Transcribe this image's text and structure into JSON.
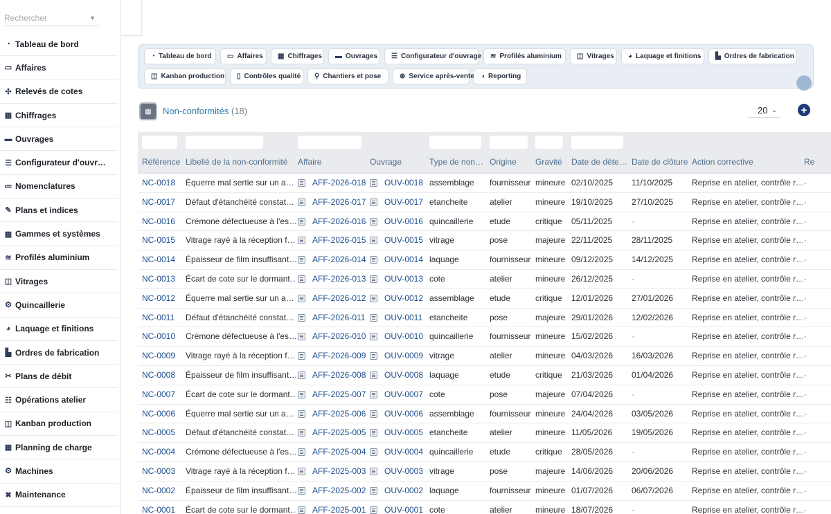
{
  "search": {
    "placeholder": "Rechercher"
  },
  "sidebar": {
    "items": [
      {
        "label": "Tableau de bord",
        "icon": "gauge-icon"
      },
      {
        "label": "Affaires",
        "icon": "briefcase-icon"
      },
      {
        "label": "Relevés de cotes",
        "icon": "move-icon"
      },
      {
        "label": "Chiffrages",
        "icon": "calculator-icon"
      },
      {
        "label": "Ouvrages",
        "icon": "window-icon"
      },
      {
        "label": "Configurateur d'ouvr…",
        "icon": "sliders-icon"
      },
      {
        "label": "Nomenclatures",
        "icon": "list-icon"
      },
      {
        "label": "Plans et indices",
        "icon": "drafting-icon"
      },
      {
        "label": "Gammes et systèmes",
        "icon": "grid-icon"
      },
      {
        "label": "Profilés aluminium",
        "icon": "layers-icon"
      },
      {
        "label": "Vitrages",
        "icon": "glass-icon"
      },
      {
        "label": "Quincaillerie",
        "icon": "gears-icon"
      },
      {
        "label": "Laquage et finitions",
        "icon": "palette-icon"
      },
      {
        "label": "Ordres de fabrication",
        "icon": "factory-icon"
      },
      {
        "label": "Plans de débit",
        "icon": "scissors-icon"
      },
      {
        "label": "Opérations atelier",
        "icon": "task-list-icon"
      },
      {
        "label": "Kanban production",
        "icon": "kanban-icon"
      },
      {
        "label": "Planning de charge",
        "icon": "calendar-icon"
      },
      {
        "label": "Machines",
        "icon": "cogs-icon"
      },
      {
        "label": "Maintenance",
        "icon": "tools-icon"
      }
    ]
  },
  "shortcuts": {
    "row1": [
      {
        "label": "Tableau de bord",
        "icon": "gauge-icon"
      },
      {
        "label": "Affaires",
        "icon": "briefcase-icon"
      },
      {
        "label": "Chiffrages",
        "icon": "calculator-icon"
      },
      {
        "label": "Ouvrages",
        "icon": "window-icon"
      },
      {
        "label": "Configurateur d'ouvrage",
        "icon": "sliders-icon"
      },
      {
        "label": "Profilés aluminium",
        "icon": "layers-icon"
      },
      {
        "label": "Vitrages",
        "icon": "glass-icon"
      },
      {
        "label": "Laquage et finitions",
        "icon": "palette-icon"
      },
      {
        "label": "Ordres de fabrication",
        "icon": "factory-icon"
      }
    ],
    "row2": [
      {
        "label": "Kanban production",
        "icon": "kanban-icon"
      },
      {
        "label": "Contrôles qualité",
        "icon": "clipboard-icon"
      },
      {
        "label": "Chantiers et pose",
        "icon": "map-pin-icon"
      },
      {
        "label": "Service après-vente",
        "icon": "lifebuoy-icon"
      },
      {
        "label": "Reporting",
        "icon": "pie-chart-icon"
      }
    ]
  },
  "list": {
    "title": "Non-conformités",
    "count": "(18)",
    "page_size": "20",
    "add_label": "+"
  },
  "table": {
    "columns": [
      "Référence",
      "Libellé de la non-conformité",
      "Affaire",
      "Ouvrage",
      "Type de non…",
      "Origine",
      "Gravité",
      "Date de déte…",
      "Date de clôture",
      "Action corrective",
      "Re"
    ],
    "rows": [
      {
        "ref": "NC-0018",
        "label": "Équerre mal sertie sur un a…",
        "affaire": "AFF-2026-018",
        "ouvrage": "OUV-0018",
        "type": "assemblage",
        "origine": "fournisseur",
        "gravite": "mineure",
        "detect": "02/10/2025",
        "cloture": "11/10/2025",
        "action": "Reprise en atelier, contrôle r…",
        "re": "-"
      },
      {
        "ref": "NC-0017",
        "label": "Défaut d'étanchéité constat…",
        "affaire": "AFF-2026-017",
        "ouvrage": "OUV-0017",
        "type": "etancheite",
        "origine": "atelier",
        "gravite": "mineure",
        "detect": "19/10/2025",
        "cloture": "27/10/2025",
        "action": "Reprise en atelier, contrôle r…",
        "re": "-"
      },
      {
        "ref": "NC-0016",
        "label": "Crémone défectueuse à l'es…",
        "affaire": "AFF-2026-016",
        "ouvrage": "OUV-0016",
        "type": "quincaillerie",
        "origine": "etude",
        "gravite": "critique",
        "detect": "05/11/2025",
        "cloture": "-",
        "action": "Reprise en atelier, contrôle r…",
        "re": "-"
      },
      {
        "ref": "NC-0015",
        "label": "Vitrage rayé à la réception f…",
        "affaire": "AFF-2026-015",
        "ouvrage": "OUV-0015",
        "type": "vitrage",
        "origine": "pose",
        "gravite": "majeure",
        "detect": "22/11/2025",
        "cloture": "28/11/2025",
        "action": "Reprise en atelier, contrôle r…",
        "re": "-"
      },
      {
        "ref": "NC-0014",
        "label": "Épaisseur de film insuffisant…",
        "affaire": "AFF-2026-014",
        "ouvrage": "OUV-0014",
        "type": "laquage",
        "origine": "fournisseur",
        "gravite": "mineure",
        "detect": "09/12/2025",
        "cloture": "14/12/2025",
        "action": "Reprise en atelier, contrôle r…",
        "re": "-"
      },
      {
        "ref": "NC-0013",
        "label": "Écart de cote sur le dormant…",
        "affaire": "AFF-2026-013",
        "ouvrage": "OUV-0013",
        "type": "cote",
        "origine": "atelier",
        "gravite": "mineure",
        "detect": "26/12/2025",
        "cloture": "-",
        "action": "Reprise en atelier, contrôle r…",
        "re": "-"
      },
      {
        "ref": "NC-0012",
        "label": "Équerre mal sertie sur un a…",
        "affaire": "AFF-2026-012",
        "ouvrage": "OUV-0012",
        "type": "assemblage",
        "origine": "etude",
        "gravite": "critique",
        "detect": "12/01/2026",
        "cloture": "27/01/2026",
        "action": "Reprise en atelier, contrôle r…",
        "re": "-"
      },
      {
        "ref": "NC-0011",
        "label": "Défaut d'étanchéité constat…",
        "affaire": "AFF-2026-011",
        "ouvrage": "OUV-0011",
        "type": "etancheite",
        "origine": "pose",
        "gravite": "majeure",
        "detect": "29/01/2026",
        "cloture": "12/02/2026",
        "action": "Reprise en atelier, contrôle r…",
        "re": "-"
      },
      {
        "ref": "NC-0010",
        "label": "Crémone défectueuse à l'es…",
        "affaire": "AFF-2026-010",
        "ouvrage": "OUV-0010",
        "type": "quincaillerie",
        "origine": "fournisseur",
        "gravite": "mineure",
        "detect": "15/02/2026",
        "cloture": "-",
        "action": "Reprise en atelier, contrôle r…",
        "re": "-"
      },
      {
        "ref": "NC-0009",
        "label": "Vitrage rayé à la réception f…",
        "affaire": "AFF-2026-009",
        "ouvrage": "OUV-0009",
        "type": "vitrage",
        "origine": "atelier",
        "gravite": "mineure",
        "detect": "04/03/2026",
        "cloture": "16/03/2026",
        "action": "Reprise en atelier, contrôle r…",
        "re": "-"
      },
      {
        "ref": "NC-0008",
        "label": "Épaisseur de film insuffisant…",
        "affaire": "AFF-2026-008",
        "ouvrage": "OUV-0008",
        "type": "laquage",
        "origine": "etude",
        "gravite": "critique",
        "detect": "21/03/2026",
        "cloture": "01/04/2026",
        "action": "Reprise en atelier, contrôle r…",
        "re": "-"
      },
      {
        "ref": "NC-0007",
        "label": "Écart de cote sur le dormant…",
        "affaire": "AFF-2025-007",
        "ouvrage": "OUV-0007",
        "type": "cote",
        "origine": "pose",
        "gravite": "majeure",
        "detect": "07/04/2026",
        "cloture": "-",
        "action": "Reprise en atelier, contrôle r…",
        "re": "-"
      },
      {
        "ref": "NC-0006",
        "label": "Équerre mal sertie sur un a…",
        "affaire": "AFF-2025-006",
        "ouvrage": "OUV-0006",
        "type": "assemblage",
        "origine": "fournisseur",
        "gravite": "mineure",
        "detect": "24/04/2026",
        "cloture": "03/05/2026",
        "action": "Reprise en atelier, contrôle r…",
        "re": "-"
      },
      {
        "ref": "NC-0005",
        "label": "Défaut d'étanchéité constat…",
        "affaire": "AFF-2025-005",
        "ouvrage": "OUV-0005",
        "type": "etancheite",
        "origine": "atelier",
        "gravite": "mineure",
        "detect": "11/05/2026",
        "cloture": "19/05/2026",
        "action": "Reprise en atelier, contrôle r…",
        "re": "-"
      },
      {
        "ref": "NC-0004",
        "label": "Crémone défectueuse à l'es…",
        "affaire": "AFF-2025-004",
        "ouvrage": "OUV-0004",
        "type": "quincaillerie",
        "origine": "etude",
        "gravite": "critique",
        "detect": "28/05/2026",
        "cloture": "-",
        "action": "Reprise en atelier, contrôle r…",
        "re": "-"
      },
      {
        "ref": "NC-0003",
        "label": "Vitrage rayé à la réception f…",
        "affaire": "AFF-2025-003",
        "ouvrage": "OUV-0003",
        "type": "vitrage",
        "origine": "pose",
        "gravite": "majeure",
        "detect": "14/06/2026",
        "cloture": "20/06/2026",
        "action": "Reprise en atelier, contrôle r…",
        "re": "-"
      },
      {
        "ref": "NC-0002",
        "label": "Épaisseur de film insuffisant…",
        "affaire": "AFF-2025-002",
        "ouvrage": "OUV-0002",
        "type": "laquage",
        "origine": "fournisseur",
        "gravite": "mineure",
        "detect": "01/07/2026",
        "cloture": "06/07/2026",
        "action": "Reprise en atelier, contrôle r…",
        "re": "-"
      },
      {
        "ref": "NC-0001",
        "label": "Écart de cote sur le dormant…",
        "affaire": "AFF-2025-001",
        "ouvrage": "OUV-0001",
        "type": "cote",
        "origine": "atelier",
        "gravite": "mineure",
        "detect": "18/07/2026",
        "cloture": "-",
        "action": "Reprise en atelier, contrôle r…",
        "re": "-"
      }
    ]
  },
  "colors": {
    "link": "#1d4f8f",
    "header_text": "#4e6e8e",
    "title": "#2a7aa8",
    "panel_bg": "#e9eef4",
    "add_button": "#1d3a78"
  }
}
